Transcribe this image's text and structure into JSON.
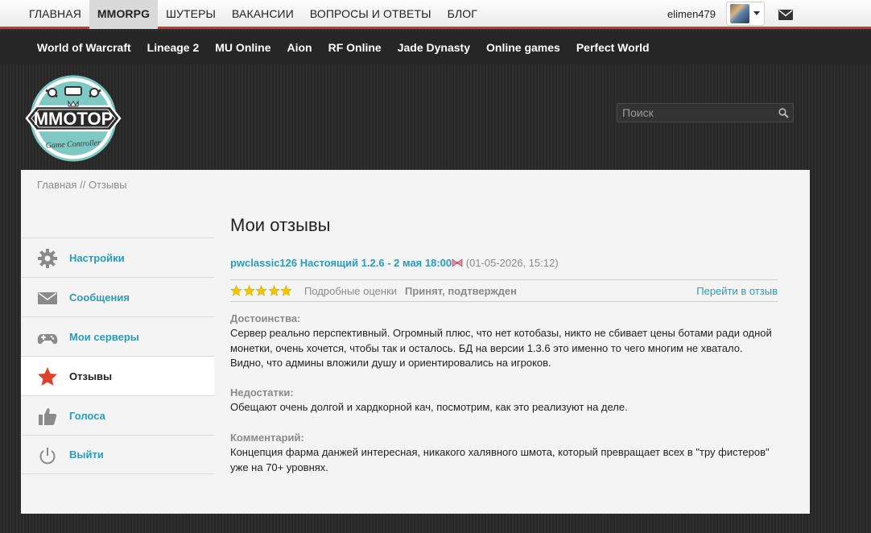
{
  "topnav": {
    "items": [
      {
        "label": "ГЛАВНАЯ"
      },
      {
        "label": "MMORPG"
      },
      {
        "label": "ШУТЕРЫ"
      },
      {
        "label": "ВАКАНСИИ"
      },
      {
        "label": "ВОПРОСЫ И ОТВЕТЫ"
      },
      {
        "label": "БЛОГ"
      }
    ],
    "active": "MMORPG",
    "username": "elimen479"
  },
  "subnav": {
    "items": [
      {
        "label": "World of Warcraft"
      },
      {
        "label": "Lineage 2"
      },
      {
        "label": "MU Online"
      },
      {
        "label": "Aion"
      },
      {
        "label": "RF Online"
      },
      {
        "label": "Jade Dynasty"
      },
      {
        "label": "Online games"
      },
      {
        "label": "Perfect World"
      }
    ]
  },
  "logo": {
    "text": "MMOTOP",
    "subtitle": "Game Controller"
  },
  "search": {
    "placeholder": "Поиск"
  },
  "breadcrumb": {
    "home": "Главная",
    "separator": " // ",
    "current": "Отзывы"
  },
  "sidebar": {
    "items": [
      {
        "label": "Настройки",
        "icon": "gear-icon"
      },
      {
        "label": "Сообщения",
        "icon": "envelope-icon"
      },
      {
        "label": "Мои серверы",
        "icon": "gamepad-icon"
      },
      {
        "label": "Отзывы",
        "icon": "star-icon"
      },
      {
        "label": "Голоса",
        "icon": "thumbs-up-icon"
      },
      {
        "label": "Выйти",
        "icon": "power-icon"
      }
    ],
    "active": "Отзывы"
  },
  "main": {
    "title": "Мои отзывы",
    "review": {
      "server_link": "pwclassic126 Настоящий 1.2.6 - 2 мая 18:00",
      "date": "(01-05-2026, 15:12)",
      "rating": 5,
      "rating_max": 5,
      "detail_label": "Подробные оценки",
      "status": "Принят, подтвержден",
      "go_label": "Перейти в отзыв",
      "pros_title": "Достоинства:",
      "pros_text": "Сервер реально перспективный. Огромный плюс, что нет котобазы, никто не сбивает цены ботами ради одной монетки, очень хочется, чтобы так и осталось. БД на версии 1.3.6 это именно то чего многим не хватало. Видно, что админы вложили душу и ориентировались на игроков.",
      "cons_title": "Недостатки:",
      "cons_text": "Обещают очень долгой и хардкорной кач, посмотрим, как это реализуют на деле.",
      "comment_title": "Комментарий:",
      "comment_text": "Концепция фарма данжей интересная, никакого халявного шмота, который превращает всех в \"тру фистеров\" уже на 70+ уровнях."
    }
  },
  "colors": {
    "accent": "#2a9bb8",
    "topbar_border": "#c63a2a",
    "star": "#f2c500",
    "active_star_icon": "#e0402a"
  }
}
